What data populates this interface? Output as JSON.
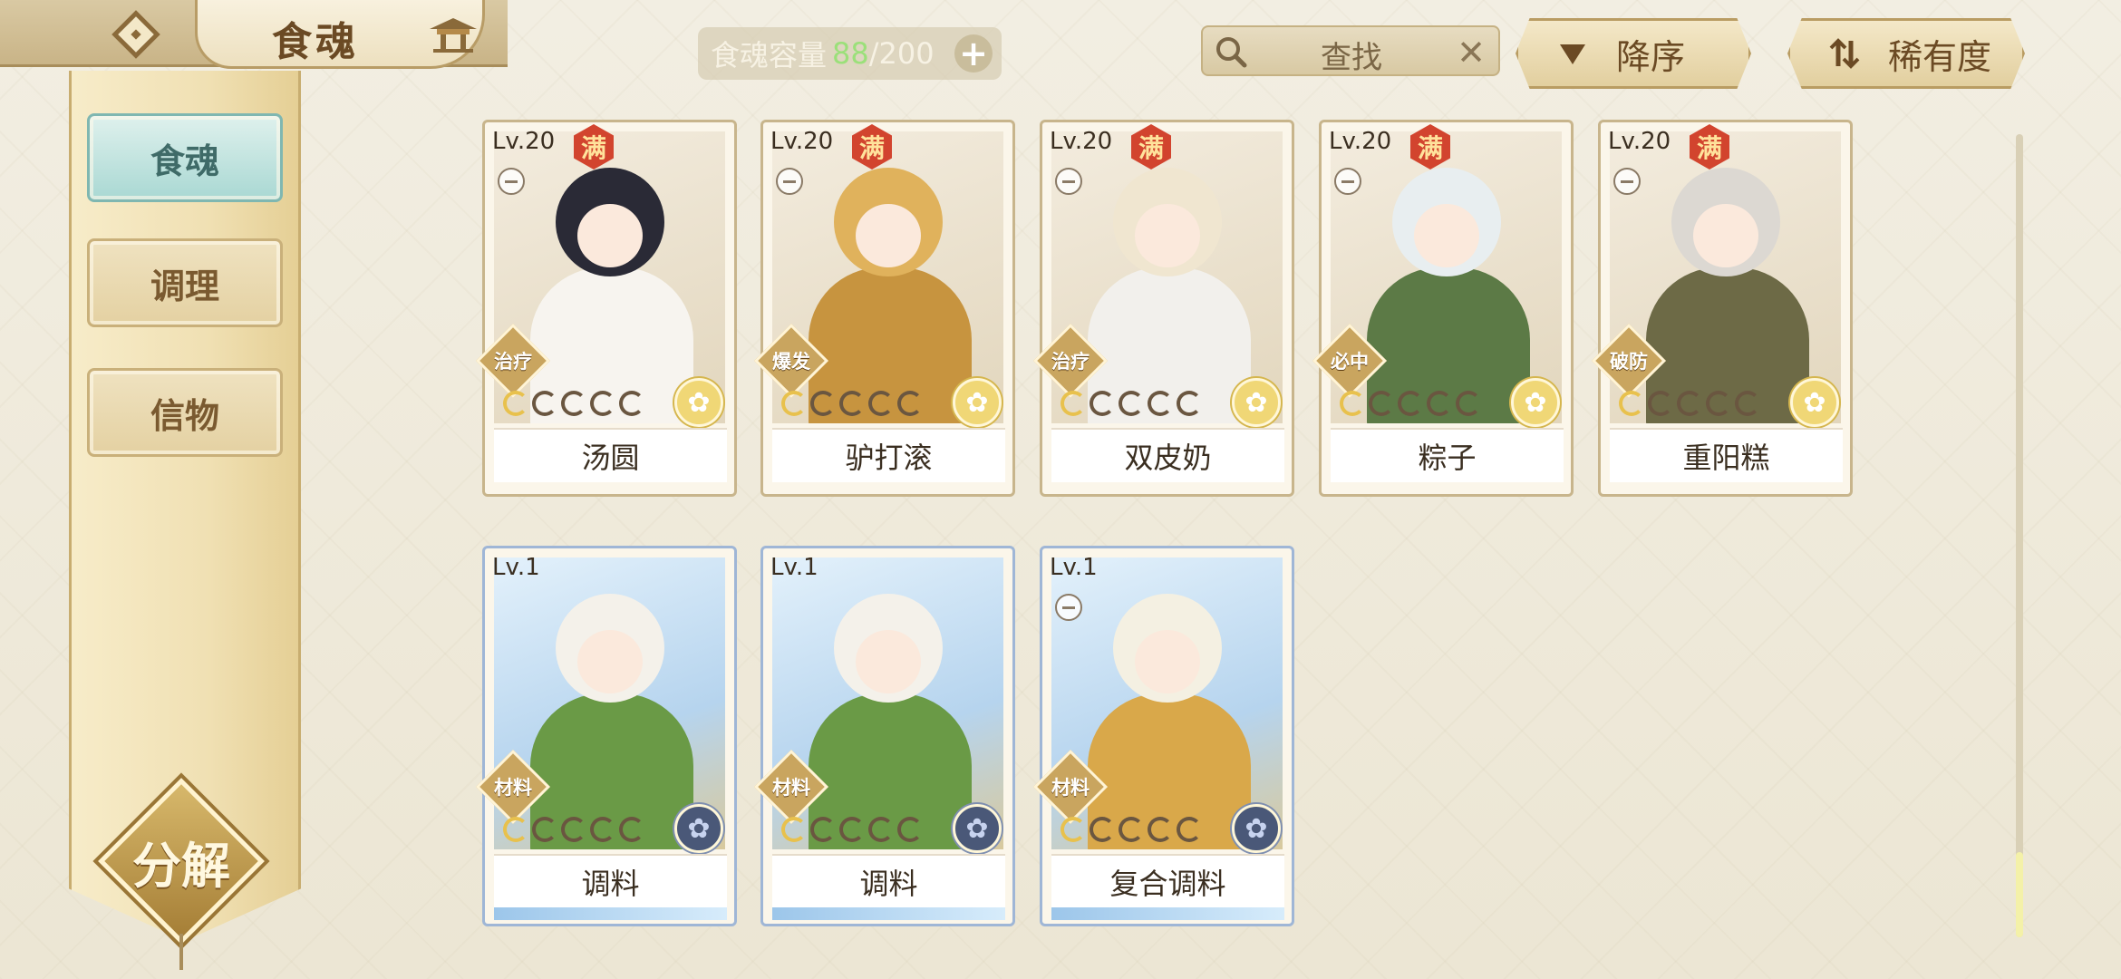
{
  "header": {
    "title": "食魂",
    "back_icon": "diamond-back-arrow-icon",
    "home_icon": "palace-icon"
  },
  "capacity": {
    "label": "食魂容量",
    "current": "88",
    "max": "/200",
    "plus_label": "+"
  },
  "search": {
    "label": "查找",
    "clear_label": "✕"
  },
  "sort": {
    "order_label": "降序",
    "rarity_label": "稀有度"
  },
  "sidebar": {
    "tabs": [
      {
        "label": "食魂",
        "active": true
      },
      {
        "label": "调理",
        "active": false
      },
      {
        "label": "信物",
        "active": false
      }
    ],
    "decompose_label": "分解"
  },
  "cards": [
    {
      "level": "Lv.20",
      "max_badge": "满",
      "role": "治疗",
      "name": "汤圆",
      "stars": 1,
      "theme": "gold"
    },
    {
      "level": "Lv.20",
      "max_badge": "满",
      "role": "爆发",
      "name": "驴打滚",
      "stars": 1,
      "theme": "gold"
    },
    {
      "level": "Lv.20",
      "max_badge": "满",
      "role": "治疗",
      "name": "双皮奶",
      "stars": 1,
      "theme": "gold"
    },
    {
      "level": "Lv.20",
      "max_badge": "满",
      "role": "必中",
      "name": "粽子",
      "stars": 1,
      "theme": "gold"
    },
    {
      "level": "Lv.20",
      "max_badge": "满",
      "role": "破防",
      "name": "重阳糕",
      "stars": 1,
      "theme": "gold"
    },
    {
      "level": "Lv.1",
      "max_badge": "",
      "role": "材料",
      "name": "调料",
      "stars": 1,
      "theme": "blue"
    },
    {
      "level": "Lv.1",
      "max_badge": "",
      "role": "材料",
      "name": "调料",
      "stars": 1,
      "theme": "blue"
    },
    {
      "level": "Lv.1",
      "max_badge": "",
      "role": "材料",
      "name": "复合调料",
      "stars": 1,
      "theme": "blue"
    }
  ],
  "colors": {
    "accent_gold": "#c9a55f",
    "active_tab": "#a9d8d3",
    "capacity_current": "#9be07a",
    "max_badge": "#d2442e"
  }
}
